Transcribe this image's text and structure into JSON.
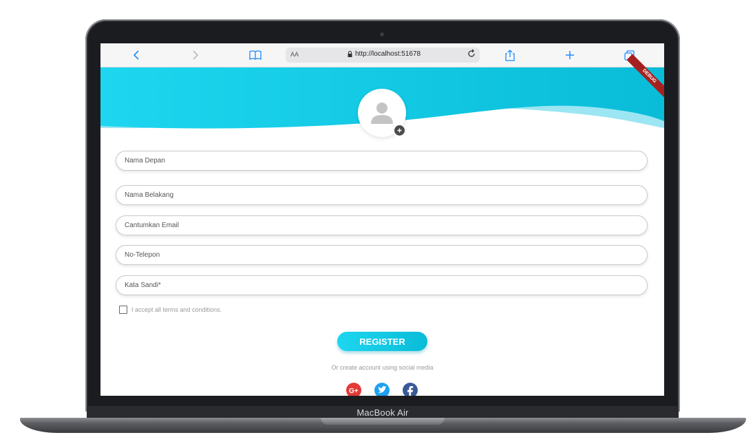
{
  "device": {
    "model": "MacBook Air"
  },
  "browser": {
    "text_size_label": "AA",
    "url": "http://localhost:51678",
    "accent": "#1a8cff"
  },
  "app": {
    "debug_banner": "DEBUG",
    "header_colors": {
      "start": "#1ed6ef",
      "end": "#09bcd8",
      "wave": "#9be6f2"
    },
    "form": {
      "first_name_placeholder": "Nama Depan",
      "last_name_placeholder": "Nama Belakang",
      "email_placeholder": "Cantumkan Email",
      "phone_placeholder": "No-Telepon",
      "password_placeholder": "Kata Sandi*",
      "terms_label": "I accept all terms and conditions."
    },
    "register_label": "REGISTER",
    "social_caption": "Or create account using social media",
    "social": [
      {
        "name": "google-plus",
        "color": "#e53935"
      },
      {
        "name": "twitter",
        "color": "#1da1f2"
      },
      {
        "name": "facebook",
        "color": "#3b5998"
      }
    ]
  }
}
